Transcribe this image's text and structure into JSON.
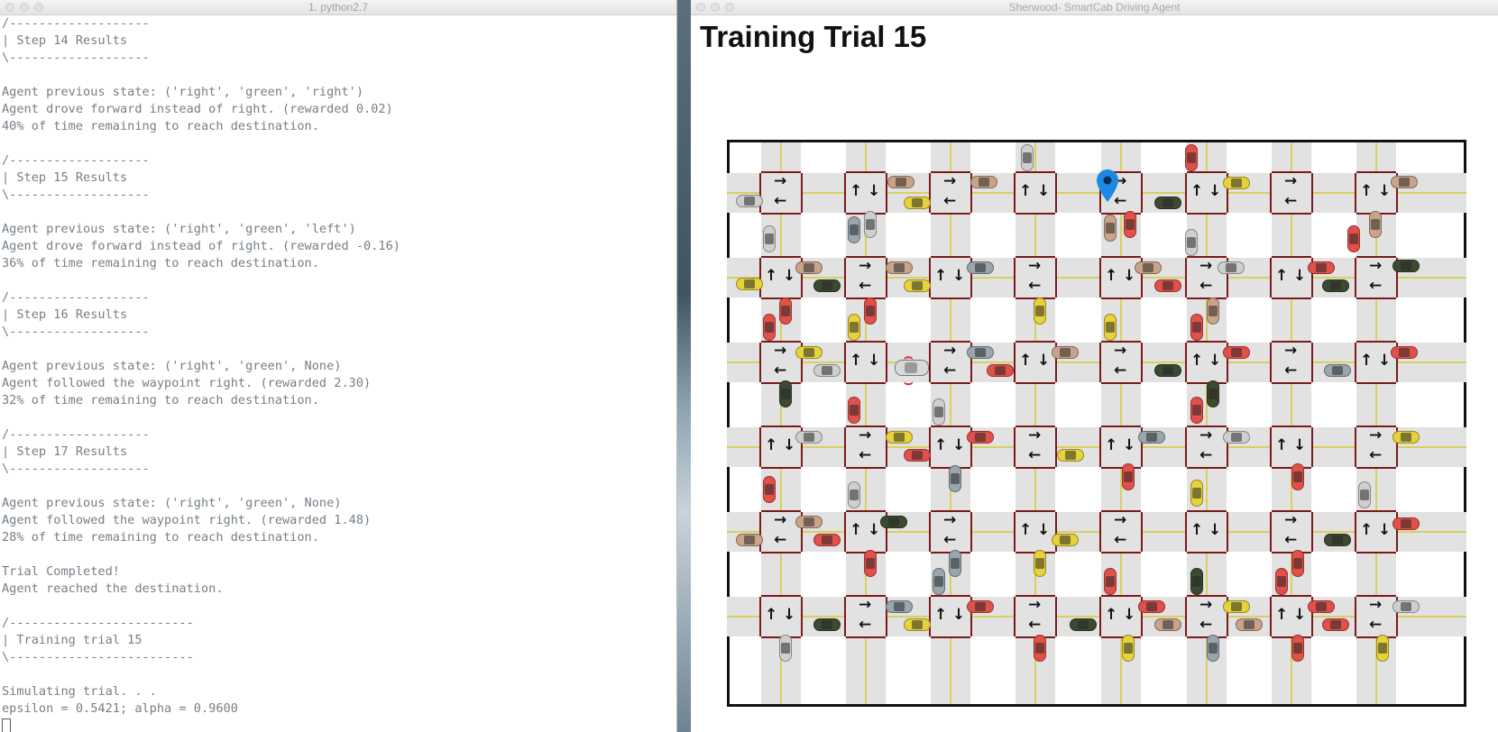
{
  "terminal": {
    "title": "1. python2.7",
    "lines": [
      "/-------------------",
      "| Step 14 Results",
      "\\-------------------",
      "",
      "Agent previous state: ('right', 'green', 'right')",
      "Agent drove forward instead of right. (rewarded 0.02)",
      "40% of time remaining to reach destination.",
      "",
      "/-------------------",
      "| Step 15 Results",
      "\\-------------------",
      "",
      "Agent previous state: ('right', 'green', 'left')",
      "Agent drove forward instead of right. (rewarded -0.16)",
      "36% of time remaining to reach destination.",
      "",
      "/-------------------",
      "| Step 16 Results",
      "\\-------------------",
      "",
      "Agent previous state: ('right', 'green', None)",
      "Agent followed the waypoint right. (rewarded 2.30)",
      "32% of time remaining to reach destination.",
      "",
      "/-------------------",
      "| Step 17 Results",
      "\\-------------------",
      "",
      "Agent previous state: ('right', 'green', None)",
      "Agent followed the waypoint right. (rewarded 1.48)",
      "28% of time remaining to reach destination.",
      "",
      "Trial Completed!",
      "Agent reached the destination.",
      "",
      "/-------------------------",
      "| Training trial 15",
      "\\-------------------------",
      "",
      "Simulating trial. . .",
      "epsilon = 0.5421; alpha = 0.9600"
    ]
  },
  "simulator": {
    "window_title": "Sherwood- SmartCab Driving Agent",
    "heading": "Training Trial 15",
    "colors": {
      "road": "#e2e2e2",
      "lane_line": "#d8d060",
      "stop_line": "#7a1a1a",
      "destination_pin": "#1e88e5",
      "car_palette": [
        "#e2504a",
        "#e6d23a",
        "#c9a48a",
        "#9aa6ae",
        "#3c4a32",
        "#cfcfcf"
      ]
    },
    "icons": {
      "destination": "map-pin-icon",
      "agent": "agent-car-icon"
    }
  }
}
